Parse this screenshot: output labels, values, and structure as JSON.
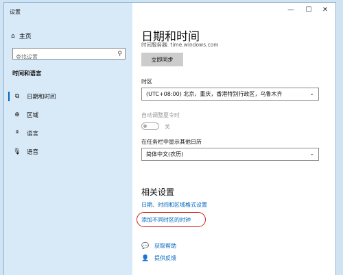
{
  "window": {
    "title": "设置",
    "minimize": "—",
    "maximize": "☐",
    "close": "✕"
  },
  "sidebar": {
    "home_label": "主页",
    "search_placeholder": "查找设置",
    "section_label": "时间和语言",
    "items": [
      {
        "label": "日期和时间",
        "icon": "calendar-clock-icon"
      },
      {
        "label": "区域",
        "icon": "globe-icon"
      },
      {
        "label": "语言",
        "icon": "language-icon"
      },
      {
        "label": "语音",
        "icon": "microphone-icon"
      }
    ]
  },
  "main": {
    "title": "日期和时间",
    "last_sync": "时间服务器: time.windows.com",
    "sync_button": "立即同步",
    "timezone_label": "时区",
    "timezone_value": "(UTC+08:00) 北京，重庆，香港特别行政区，乌鲁木齐",
    "dst_label": "自动调整夏令时",
    "dst_state": "关",
    "calendar_label": "在任务栏中显示其他日历",
    "calendar_value": "简体中文(农历)",
    "related_title": "相关设置",
    "related_links": [
      "日期、时间和区域格式设置",
      "添加不同时区的时钟"
    ],
    "help_label": "获取帮助",
    "feedback_label": "提供反馈"
  },
  "colors": {
    "accent": "#0067c0",
    "highlight_oval": "#d0201a",
    "sidebar_bg": "#d8e9f7"
  }
}
